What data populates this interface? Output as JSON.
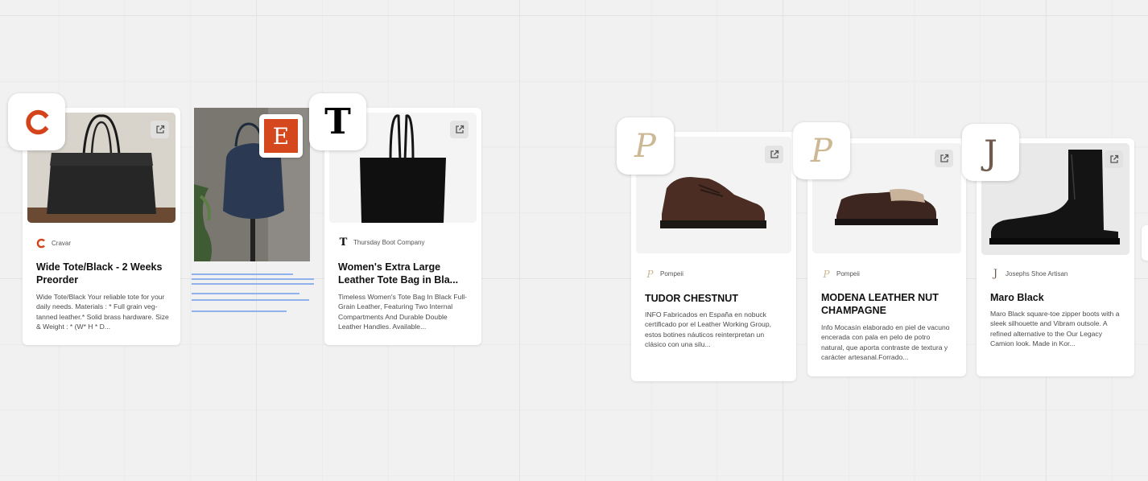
{
  "cards": {
    "cravar": {
      "source": "Cravar",
      "title": "Wide Tote/Black - 2 Weeks Preorder",
      "description": "Wide Tote/Black Your reliable tote for your daily needs. Materials : * Full grain veg-tanned leather.* Solid brass hardware. Size & Weight : * (W* H * D..."
    },
    "thursday": {
      "source": "Thursday Boot Company",
      "title": "Women's Extra Large Leather Tote Bag in Bla...",
      "description": "Timeless Women's Tote Bag In Black Full-Grain Leather, Featuring Two Internal Compartments And Durable Double Leather Handles. Available..."
    },
    "tudor": {
      "source": "Pompeii",
      "title": "TUDOR CHESTNUT",
      "description": "INFO Fabricados en España en nobuck certificado por el Leather Working Group, estos botines náuticos reinterpretan un clásico con una silu..."
    },
    "modena": {
      "source": "Pompeii",
      "title": "MODENA LEATHER NUT CHAMPAGNE",
      "description": "Info Mocasín elaborado en piel de vacuno encerada con pala en pelo de potro natural, que aporta contraste de textura y carácter artesanal.Forrado..."
    },
    "maro": {
      "source": "Josephs Shoe Artisan",
      "title": "Maro Black",
      "description": "Maro Black square-toe zipper boots with a sleek silhouette and Vibram outsole. A refined alternative to the Our Legacy Camion look. Made in Kor..."
    }
  },
  "badges": {
    "cravar": "C",
    "etsy": "E",
    "thursday": "T",
    "pompeii": "P",
    "josephs": "J"
  },
  "icons": {
    "open_link": "external-link-icon"
  },
  "colors": {
    "cravar_brand": "#d4441c",
    "etsy_brand": "#d5471d",
    "pompeii_brand": "#cdb894",
    "josephs_brand": "#6f5a4d",
    "skeleton": "#8fb1ec"
  }
}
